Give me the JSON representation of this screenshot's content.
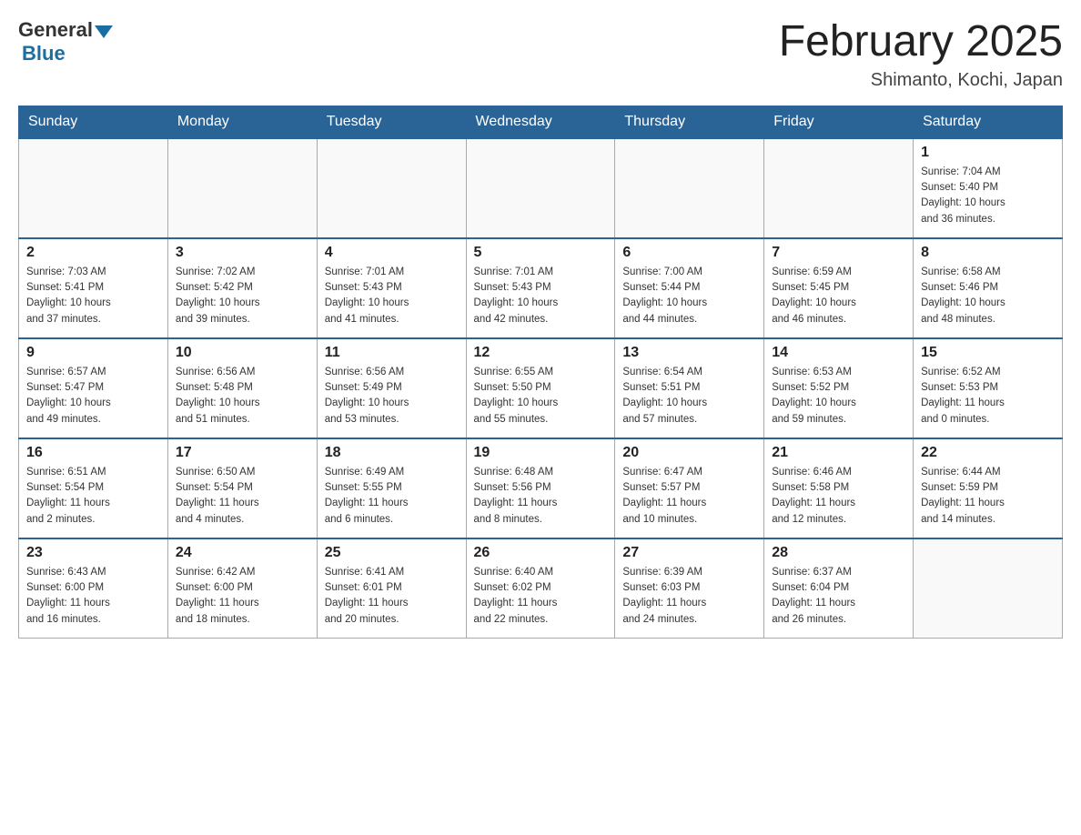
{
  "header": {
    "logo_general": "General",
    "logo_blue": "Blue",
    "month_title": "February 2025",
    "location": "Shimanto, Kochi, Japan"
  },
  "days_of_week": [
    "Sunday",
    "Monday",
    "Tuesday",
    "Wednesday",
    "Thursday",
    "Friday",
    "Saturday"
  ],
  "weeks": [
    [
      {
        "day": "",
        "info": ""
      },
      {
        "day": "",
        "info": ""
      },
      {
        "day": "",
        "info": ""
      },
      {
        "day": "",
        "info": ""
      },
      {
        "day": "",
        "info": ""
      },
      {
        "day": "",
        "info": ""
      },
      {
        "day": "1",
        "info": "Sunrise: 7:04 AM\nSunset: 5:40 PM\nDaylight: 10 hours\nand 36 minutes."
      }
    ],
    [
      {
        "day": "2",
        "info": "Sunrise: 7:03 AM\nSunset: 5:41 PM\nDaylight: 10 hours\nand 37 minutes."
      },
      {
        "day": "3",
        "info": "Sunrise: 7:02 AM\nSunset: 5:42 PM\nDaylight: 10 hours\nand 39 minutes."
      },
      {
        "day": "4",
        "info": "Sunrise: 7:01 AM\nSunset: 5:43 PM\nDaylight: 10 hours\nand 41 minutes."
      },
      {
        "day": "5",
        "info": "Sunrise: 7:01 AM\nSunset: 5:43 PM\nDaylight: 10 hours\nand 42 minutes."
      },
      {
        "day": "6",
        "info": "Sunrise: 7:00 AM\nSunset: 5:44 PM\nDaylight: 10 hours\nand 44 minutes."
      },
      {
        "day": "7",
        "info": "Sunrise: 6:59 AM\nSunset: 5:45 PM\nDaylight: 10 hours\nand 46 minutes."
      },
      {
        "day": "8",
        "info": "Sunrise: 6:58 AM\nSunset: 5:46 PM\nDaylight: 10 hours\nand 48 minutes."
      }
    ],
    [
      {
        "day": "9",
        "info": "Sunrise: 6:57 AM\nSunset: 5:47 PM\nDaylight: 10 hours\nand 49 minutes."
      },
      {
        "day": "10",
        "info": "Sunrise: 6:56 AM\nSunset: 5:48 PM\nDaylight: 10 hours\nand 51 minutes."
      },
      {
        "day": "11",
        "info": "Sunrise: 6:56 AM\nSunset: 5:49 PM\nDaylight: 10 hours\nand 53 minutes."
      },
      {
        "day": "12",
        "info": "Sunrise: 6:55 AM\nSunset: 5:50 PM\nDaylight: 10 hours\nand 55 minutes."
      },
      {
        "day": "13",
        "info": "Sunrise: 6:54 AM\nSunset: 5:51 PM\nDaylight: 10 hours\nand 57 minutes."
      },
      {
        "day": "14",
        "info": "Sunrise: 6:53 AM\nSunset: 5:52 PM\nDaylight: 10 hours\nand 59 minutes."
      },
      {
        "day": "15",
        "info": "Sunrise: 6:52 AM\nSunset: 5:53 PM\nDaylight: 11 hours\nand 0 minutes."
      }
    ],
    [
      {
        "day": "16",
        "info": "Sunrise: 6:51 AM\nSunset: 5:54 PM\nDaylight: 11 hours\nand 2 minutes."
      },
      {
        "day": "17",
        "info": "Sunrise: 6:50 AM\nSunset: 5:54 PM\nDaylight: 11 hours\nand 4 minutes."
      },
      {
        "day": "18",
        "info": "Sunrise: 6:49 AM\nSunset: 5:55 PM\nDaylight: 11 hours\nand 6 minutes."
      },
      {
        "day": "19",
        "info": "Sunrise: 6:48 AM\nSunset: 5:56 PM\nDaylight: 11 hours\nand 8 minutes."
      },
      {
        "day": "20",
        "info": "Sunrise: 6:47 AM\nSunset: 5:57 PM\nDaylight: 11 hours\nand 10 minutes."
      },
      {
        "day": "21",
        "info": "Sunrise: 6:46 AM\nSunset: 5:58 PM\nDaylight: 11 hours\nand 12 minutes."
      },
      {
        "day": "22",
        "info": "Sunrise: 6:44 AM\nSunset: 5:59 PM\nDaylight: 11 hours\nand 14 minutes."
      }
    ],
    [
      {
        "day": "23",
        "info": "Sunrise: 6:43 AM\nSunset: 6:00 PM\nDaylight: 11 hours\nand 16 minutes."
      },
      {
        "day": "24",
        "info": "Sunrise: 6:42 AM\nSunset: 6:00 PM\nDaylight: 11 hours\nand 18 minutes."
      },
      {
        "day": "25",
        "info": "Sunrise: 6:41 AM\nSunset: 6:01 PM\nDaylight: 11 hours\nand 20 minutes."
      },
      {
        "day": "26",
        "info": "Sunrise: 6:40 AM\nSunset: 6:02 PM\nDaylight: 11 hours\nand 22 minutes."
      },
      {
        "day": "27",
        "info": "Sunrise: 6:39 AM\nSunset: 6:03 PM\nDaylight: 11 hours\nand 24 minutes."
      },
      {
        "day": "28",
        "info": "Sunrise: 6:37 AM\nSunset: 6:04 PM\nDaylight: 11 hours\nand 26 minutes."
      },
      {
        "day": "",
        "info": ""
      }
    ]
  ]
}
